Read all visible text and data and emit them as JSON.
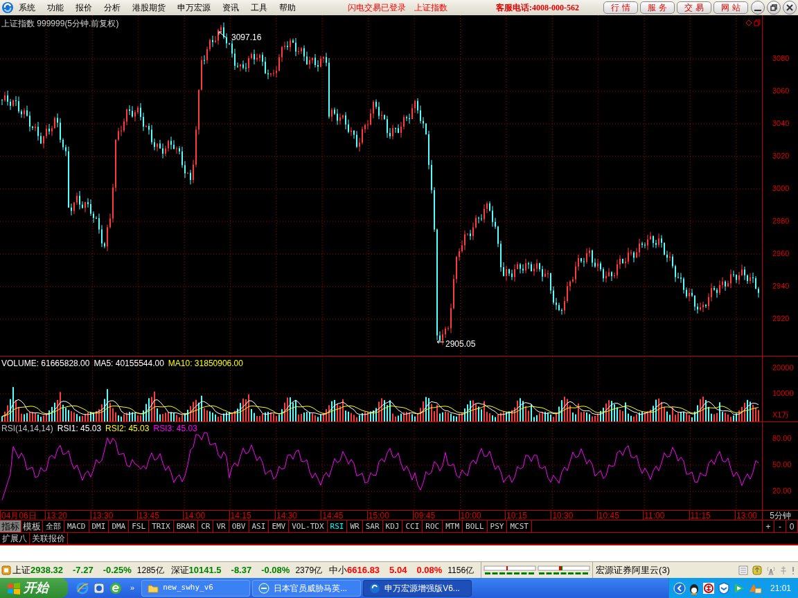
{
  "menu_bar": {
    "items": [
      "系统",
      "功能",
      "报价",
      "分析",
      "港股期货",
      "申万宏源",
      "资讯",
      "工具",
      "帮助"
    ],
    "notices": [
      "闪电交易已登录",
      "上证指数"
    ],
    "hotline": "客服电话:4008-000-562",
    "buttons": [
      "行 情",
      "服 务",
      "交 易",
      "网 站"
    ]
  },
  "chart": {
    "title": "上证指数 999999(5分钟.前复权)",
    "price_axis": [
      "3080",
      "3060",
      "3040",
      "3020",
      "3000",
      "2980",
      "2960",
      "2940",
      "2920"
    ],
    "high_label": "3097.16",
    "low_label": "2905.05",
    "volume_header": [
      {
        "text": "VOLUME: 61665828.00",
        "color": "#ffffff"
      },
      {
        "text": "MA5: 40155544.00",
        "color": "#ffffff"
      },
      {
        "text": "MA10: 31850906.00",
        "color": "#ffff00"
      }
    ],
    "volume_axis": [
      "20000",
      "10000",
      "X1万"
    ],
    "rsi_header": [
      {
        "text": "RSI(14,14,14)",
        "color": "#c0c0c0"
      },
      {
        "text": "RSI1: 45.03",
        "color": "#ffffff"
      },
      {
        "text": "RSI2: 45.03",
        "color": "#ffff00"
      },
      {
        "text": "RSI3: 45.03",
        "color": "#ff00ff"
      }
    ],
    "rsi_axis": [
      "80.00",
      "50.00",
      "20.00"
    ],
    "time_axis": [
      "04月06日",
      "13:20",
      "13:30",
      "13:45",
      "14:00",
      "14:15",
      "14:30",
      "14:45",
      "15:00",
      "09:45",
      "10:00",
      "10:15",
      "10:30",
      "10:45",
      "11:00",
      "11:15",
      "13:00"
    ],
    "period_label": "5分钟"
  },
  "mode_tabs": [
    {
      "label": "指标",
      "selected": true
    },
    {
      "label": "模板",
      "selected": false
    }
  ],
  "indicator_tabs": [
    {
      "label": "全部",
      "selected": false
    },
    {
      "label": "MACD",
      "selected": false
    },
    {
      "label": "DMI",
      "selected": false
    },
    {
      "label": "DMA",
      "selected": false
    },
    {
      "label": "FSL",
      "selected": false
    },
    {
      "label": "TRIX",
      "selected": false
    },
    {
      "label": "BRAR",
      "selected": false
    },
    {
      "label": "CR",
      "selected": false
    },
    {
      "label": "VR",
      "selected": false
    },
    {
      "label": "OBV",
      "selected": false
    },
    {
      "label": "ASI",
      "selected": false
    },
    {
      "label": "EMV",
      "selected": false
    },
    {
      "label": "VOL-TDX",
      "selected": false
    },
    {
      "label": "RSI",
      "selected": true
    },
    {
      "label": "WR",
      "selected": false
    },
    {
      "label": "SAR",
      "selected": false
    },
    {
      "label": "KDJ",
      "selected": false
    },
    {
      "label": "CCI",
      "selected": false
    },
    {
      "label": "ROC",
      "selected": false
    },
    {
      "label": "MTM",
      "selected": false
    },
    {
      "label": "BOLL",
      "selected": false
    },
    {
      "label": "PSY",
      "selected": false
    },
    {
      "label": "MCST",
      "selected": false
    }
  ],
  "zoom_buttons": [
    "+",
    "-",
    "0"
  ],
  "bottom_tabs": [
    "扩展八",
    "关联报价"
  ],
  "status_bar": {
    "indices": [
      {
        "name": "上证",
        "value": "2938.32",
        "change": "-7.27",
        "percent": "-0.25%",
        "amount": "1285亿",
        "color": "#008000"
      },
      {
        "name": "深证",
        "value": "10141.5",
        "change": "-8.37",
        "percent": "-0.08%",
        "amount": "2379亿",
        "color": "#008000"
      },
      {
        "name": "中小",
        "value": "6616.83",
        "change": "5.04",
        "percent": "0.08%",
        "amount": "1156亿",
        "color": "#ff0000"
      }
    ],
    "server": "宏源证券阿里云(3)"
  },
  "taskbar": {
    "start": "开始",
    "more": "»",
    "windows": [
      {
        "label": "new_swhy_v6",
        "kind": "folder",
        "selected": false
      },
      {
        "label": "日本官员威胁马英...",
        "kind": "browser",
        "selected": false
      },
      {
        "label": "申万宏源增强版V6...",
        "kind": "app",
        "selected": true
      }
    ],
    "clock": "21:01"
  }
}
